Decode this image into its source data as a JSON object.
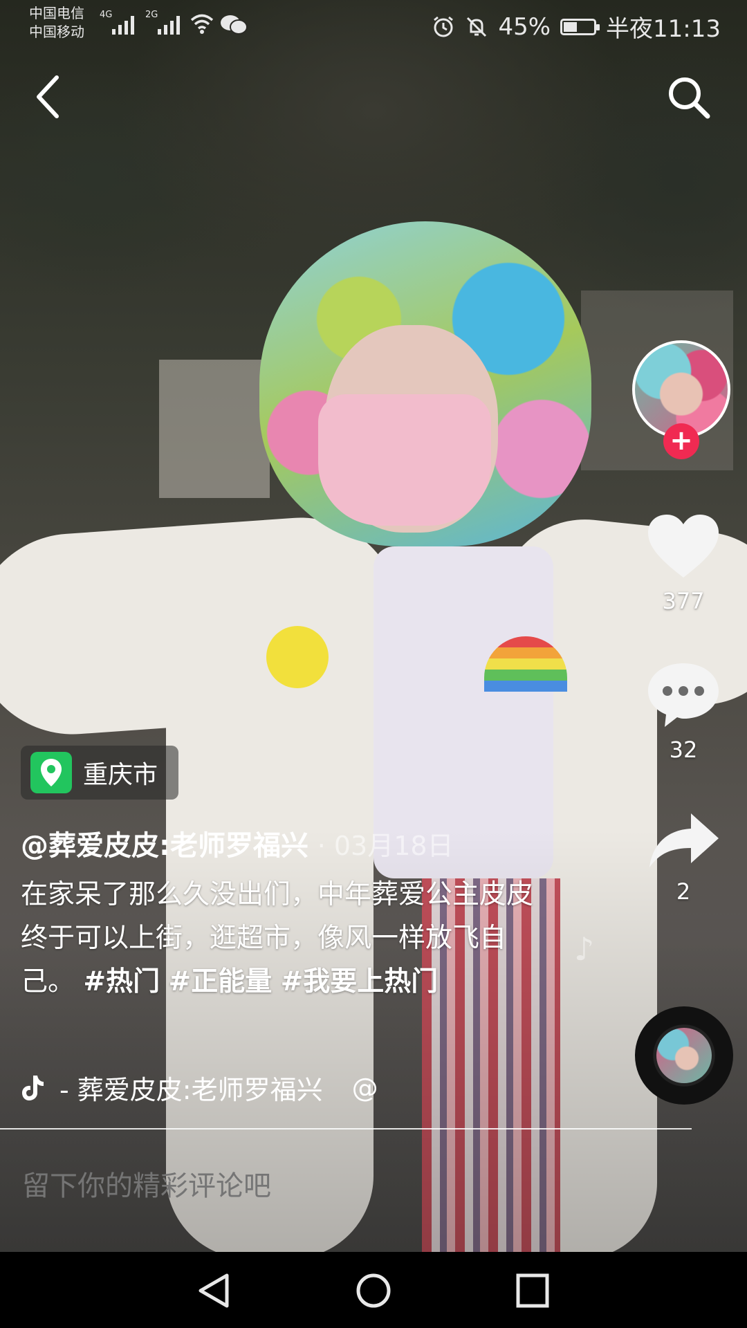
{
  "status_bar": {
    "carrier_1": "中国电信",
    "carrier_2": "中国移动",
    "net_1": "4G",
    "net_2": "2G",
    "battery_percent": "45%",
    "battery_level": 0.45,
    "time": "半夜11:13"
  },
  "video": {
    "location": "重庆市",
    "author": "@葬爱皮皮:老师罗福兴",
    "date": "· 03月18日",
    "caption_text": "在家呆了那么久没出们，中年葬爱公主皮皮终于可以上街，逛超市，像风一样放飞自己。",
    "hashtags": [
      "#热门",
      "#正能量",
      "#我要上热门"
    ],
    "music": "- 葬爱皮皮:老师罗福兴",
    "music_trail": "@"
  },
  "actions": {
    "follow_label": "+",
    "likes": "377",
    "comments": "32",
    "shares": "2"
  },
  "comment_box": {
    "placeholder": "留下你的精彩评论吧"
  },
  "icons": {
    "back": "back-arrow-icon",
    "search": "search-icon",
    "like": "heart-icon",
    "comment": "comment-bubble-icon",
    "share": "share-arrow-icon",
    "music": "tiktok-note-icon",
    "location": "location-pin-icon"
  },
  "colors": {
    "follow_red": "#f02a52",
    "location_green": "#22c55e"
  }
}
